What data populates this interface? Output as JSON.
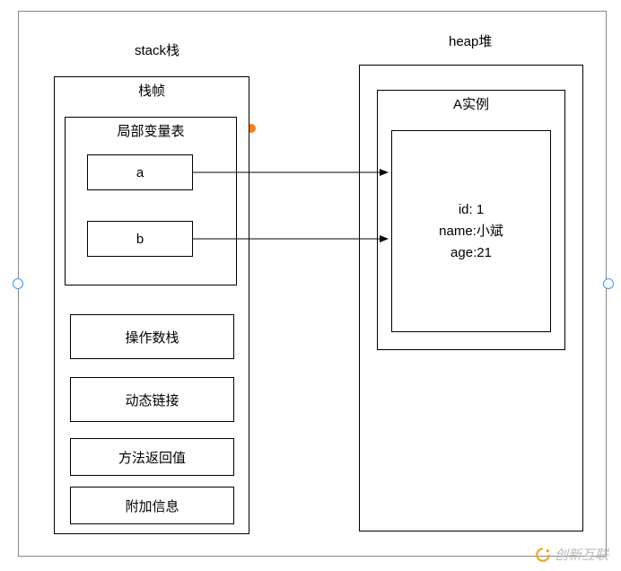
{
  "stack": {
    "title": "stack栈",
    "frame": {
      "title": "栈帧",
      "localVarTable": {
        "title": "局部变量表",
        "vars": {
          "a": "a",
          "b": "b"
        }
      },
      "sections": {
        "operandStack": "操作数栈",
        "dynamicLink": "动态链接",
        "returnValue": "方法返回值",
        "extraInfo": "附加信息"
      }
    }
  },
  "heap": {
    "title": "heap堆",
    "instance": {
      "title": "A实例",
      "fields": {
        "id": "id: 1",
        "name": "name:小斌",
        "age": "age:21"
      }
    }
  },
  "watermark": "创新互联"
}
